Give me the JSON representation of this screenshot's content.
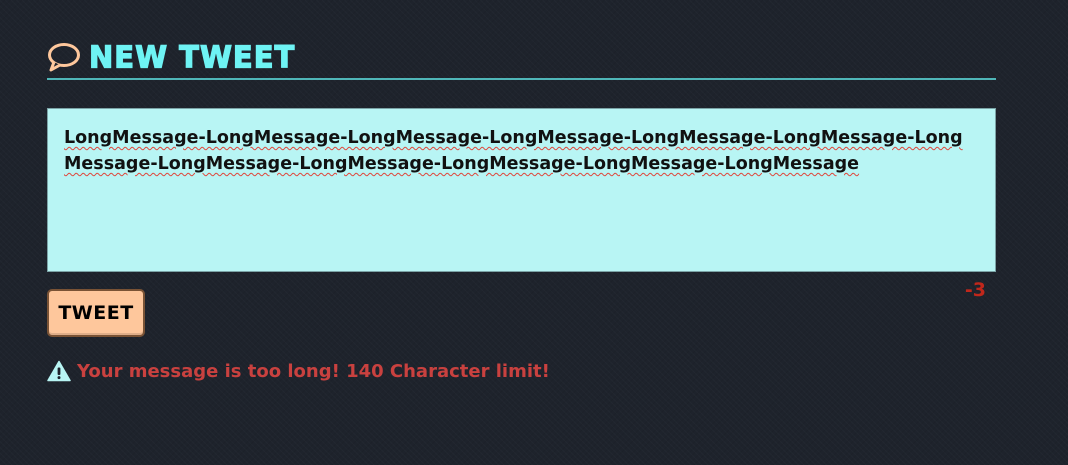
{
  "compose": {
    "title": "New Tweet",
    "title_icon": "speech-bubble-icon",
    "tweet_text": "LongMessage-LongMessage-LongMessage-LongMessage-LongMessage-LongMessage-LongMessage-LongMessage-LongMessage-LongMessage-LongMessage-LongMessage",
    "char_counter": "-3",
    "submit_label": "Tweet",
    "error_icon": "warning-icon",
    "error_message": "Your message is too long! 140 Character limit!"
  },
  "colors": {
    "background": "#1e232c",
    "title": "#6ef3f4",
    "icon": "#fec79c",
    "textarea_bg": "#b8f5f4",
    "button_bg": "#fec79c",
    "counter": "#c0271b",
    "error": "#c9413f"
  }
}
